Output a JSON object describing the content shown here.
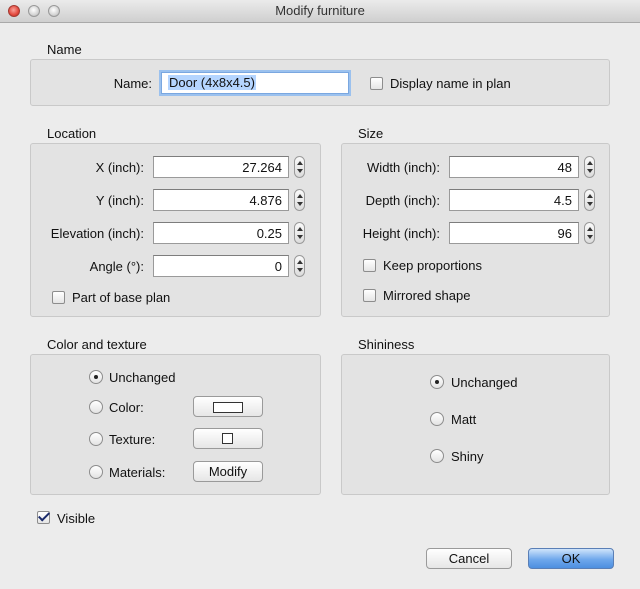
{
  "window": {
    "title": "Modify furniture"
  },
  "name_section": {
    "group_label": "Name",
    "name_label": "Name:",
    "name_value": "Door (4x8x4.5)",
    "display_name_label": "Display name in plan",
    "display_name_checked": false
  },
  "location": {
    "group_label": "Location",
    "x_label": "X (inch):",
    "x_value": "27.264",
    "y_label": "Y (inch):",
    "y_value": "4.876",
    "elevation_label": "Elevation (inch):",
    "elevation_value": "0.25",
    "angle_label": "Angle (°):",
    "angle_value": "0",
    "base_plan_label": "Part of base plan",
    "base_plan_checked": false
  },
  "size": {
    "group_label": "Size",
    "width_label": "Width (inch):",
    "width_value": "48",
    "depth_label": "Depth (inch):",
    "depth_value": "4.5",
    "height_label": "Height (inch):",
    "height_value": "96",
    "keep_proportions_label": "Keep proportions",
    "mirrored_label": "Mirrored shape"
  },
  "color_texture": {
    "group_label": "Color and texture",
    "unchanged_label": "Unchanged",
    "color_label": "Color:",
    "texture_label": "Texture:",
    "materials_label": "Materials:",
    "modify_button": "Modify",
    "selected": "Unchanged"
  },
  "shininess": {
    "group_label": "Shininess",
    "unchanged_label": "Unchanged",
    "matt_label": "Matt",
    "shiny_label": "Shiny",
    "selected": "Unchanged"
  },
  "visible": {
    "label": "Visible",
    "checked": true
  },
  "buttons": {
    "cancel": "Cancel",
    "ok": "OK"
  },
  "colors": {
    "default_button": "#6fa8ec",
    "focus_ring": "#9bc1ee",
    "panel_bg": "#e3e3e3"
  }
}
